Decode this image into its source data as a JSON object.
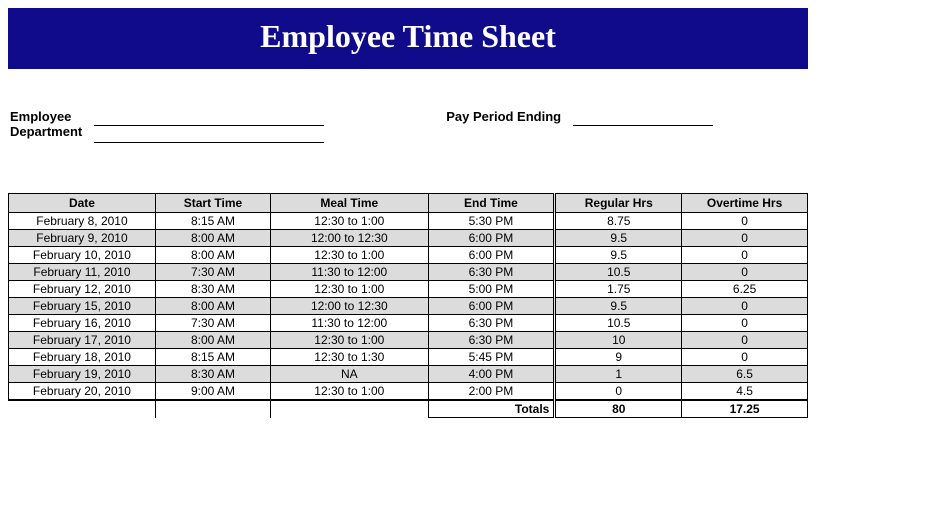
{
  "title": "Employee Time Sheet",
  "labels": {
    "employee": "Employee",
    "department": "Department",
    "pay_period_ending": "Pay Period Ending"
  },
  "fields": {
    "employee": "",
    "department": "",
    "pay_period_ending": ""
  },
  "columns": {
    "date": "Date",
    "start": "Start Time",
    "meal": "Meal Time",
    "end": "End Time",
    "regular": "Regular Hrs",
    "overtime": "Overtime Hrs"
  },
  "totals_label": "Totals",
  "totals": {
    "regular": "80",
    "overtime": "17.25"
  },
  "chart_data": {
    "type": "table",
    "columns": [
      "Date",
      "Start Time",
      "Meal Time",
      "End Time",
      "Regular Hrs",
      "Overtime Hrs"
    ],
    "rows": [
      {
        "date": "February 8, 2010",
        "start": "8:15 AM",
        "meal": "12:30 to 1:00",
        "end": "5:30 PM",
        "regular": "8.75",
        "overtime": "0"
      },
      {
        "date": "February 9, 2010",
        "start": "8:00 AM",
        "meal": "12:00 to 12:30",
        "end": "6:00 PM",
        "regular": "9.5",
        "overtime": "0"
      },
      {
        "date": "February 10, 2010",
        "start": "8:00 AM",
        "meal": "12:30 to 1:00",
        "end": "6:00 PM",
        "regular": "9.5",
        "overtime": "0"
      },
      {
        "date": "February 11, 2010",
        "start": "7:30 AM",
        "meal": "11:30 to 12:00",
        "end": "6:30 PM",
        "regular": "10.5",
        "overtime": "0"
      },
      {
        "date": "February 12, 2010",
        "start": "8:30 AM",
        "meal": "12:30 to 1:00",
        "end": "5:00 PM",
        "regular": "1.75",
        "overtime": "6.25"
      },
      {
        "date": "February 15, 2010",
        "start": "8:00 AM",
        "meal": "12:00 to 12:30",
        "end": "6:00 PM",
        "regular": "9.5",
        "overtime": "0"
      },
      {
        "date": "February 16, 2010",
        "start": "7:30 AM",
        "meal": "11:30 to 12:00",
        "end": "6:30 PM",
        "regular": "10.5",
        "overtime": "0"
      },
      {
        "date": "February 17, 2010",
        "start": "8:00 AM",
        "meal": "12:30 to 1:00",
        "end": "6:30 PM",
        "regular": "10",
        "overtime": "0"
      },
      {
        "date": "February 18, 2010",
        "start": "8:15 AM",
        "meal": "12:30 to 1:30",
        "end": "5:45 PM",
        "regular": "9",
        "overtime": "0"
      },
      {
        "date": "February 19, 2010",
        "start": "8:30 AM",
        "meal": "NA",
        "end": "4:00 PM",
        "regular": "1",
        "overtime": "6.5"
      },
      {
        "date": "February 20, 2010",
        "start": "9:00 AM",
        "meal": "12:30 to 1:00",
        "end": "2:00 PM",
        "regular": "0",
        "overtime": "4.5"
      }
    ]
  }
}
